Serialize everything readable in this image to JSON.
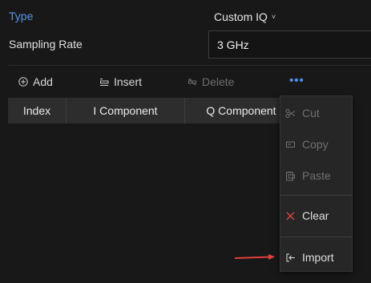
{
  "header": {
    "type_label": "Type",
    "type_value": "Custom IQ",
    "type_chevron": "˅",
    "sampling_rate_label": "Sampling Rate",
    "sampling_rate_value": "3 GHz"
  },
  "toolbar": {
    "add_label": "Add",
    "insert_label": "Insert",
    "delete_label": "Delete",
    "more_label": "•••"
  },
  "table": {
    "columns": [
      "Index",
      "I Component",
      "Q Component"
    ]
  },
  "context_menu": {
    "items": [
      {
        "label": "Cut",
        "icon": "scissors-icon",
        "enabled": false
      },
      {
        "label": "Copy",
        "icon": "copy-icon",
        "enabled": false
      },
      {
        "label": "Paste",
        "icon": "paste-icon",
        "enabled": false
      },
      {
        "label": "Clear",
        "icon": "close-icon",
        "enabled": true
      },
      {
        "label": "Import",
        "icon": "import-icon",
        "enabled": true
      }
    ]
  },
  "colors": {
    "accent": "#5b96ea",
    "clear_icon": "#e0454a",
    "annotation_arrow": "#e0403a"
  }
}
